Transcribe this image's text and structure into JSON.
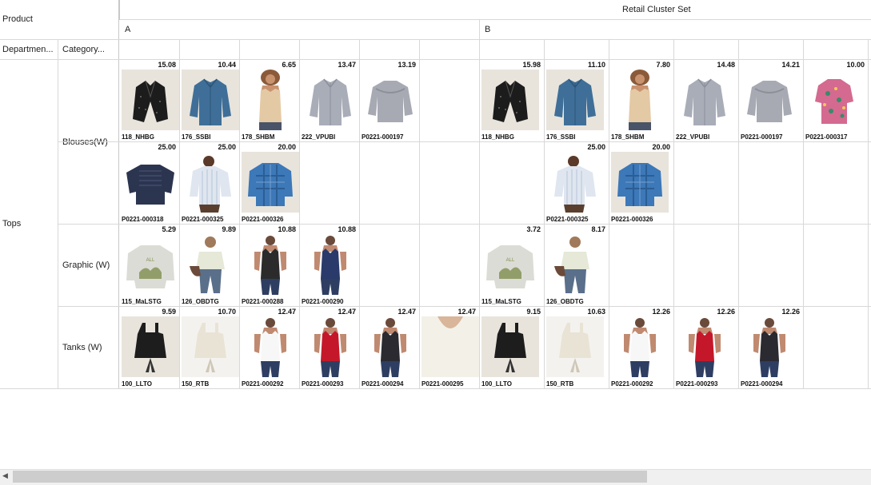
{
  "grid": {
    "row_dim_label": "Product",
    "col_dim_title": "Retail Cluster Set",
    "col_headers": [
      "Departmen...",
      "Category..."
    ],
    "clusters": [
      {
        "label": "A"
      },
      {
        "label": "B"
      }
    ],
    "department": "Tops",
    "categories": [
      {
        "label": "Blouses(W)"
      },
      {
        "label": "Graphic (W)"
      },
      {
        "label": "Tanks (W)"
      }
    ]
  },
  "rows": [
    {
      "A": [
        {
          "price": "15.08",
          "code": "118_NHBG",
          "kind": "blazer",
          "colors": [
            "#1c1c1c",
            "#bfbfbf"
          ],
          "bg": "#e8e4dc"
        },
        {
          "price": "10.44",
          "code": "176_SSBI",
          "kind": "shirt",
          "colors": [
            "#3f6f98",
            "#2c5578"
          ],
          "bg": "#e8e4dc"
        },
        {
          "price": "6.65",
          "code": "178_SHBM",
          "kind": "tank_model",
          "colors": [
            "#e4c9a5",
            "#8a5a3a"
          ],
          "bg": "#ffffff"
        },
        {
          "price": "13.47",
          "code": "222_VPUBI",
          "kind": "shirt",
          "colors": [
            "#a9adb8",
            "#8c909c"
          ],
          "bg": "#ffffff"
        },
        {
          "price": "13.19",
          "code": "P0221-000197",
          "kind": "ruffle",
          "colors": [
            "#a7aab3",
            "#8d9099"
          ],
          "bg": "#ffffff"
        },
        null
      ],
      "B": [
        {
          "price": "15.98",
          "code": "118_NHBG",
          "kind": "blazer",
          "colors": [
            "#1c1c1c",
            "#bfbfbf"
          ],
          "bg": "#e8e4dc"
        },
        {
          "price": "11.10",
          "code": "176_SSBI",
          "kind": "shirt",
          "colors": [
            "#3f6f98",
            "#2c5578"
          ],
          "bg": "#e8e4dc"
        },
        {
          "price": "7.80",
          "code": "178_SHBM",
          "kind": "tank_model",
          "colors": [
            "#e4c9a5",
            "#8a5a3a"
          ],
          "bg": "#ffffff"
        },
        {
          "price": "14.48",
          "code": "222_VPUBI",
          "kind": "shirt",
          "colors": [
            "#a9adb8",
            "#8c909c"
          ],
          "bg": "#ffffff"
        },
        {
          "price": "14.21",
          "code": "P0221-000197",
          "kind": "ruffle",
          "colors": [
            "#a7aab3",
            "#8d9099"
          ],
          "bg": "#ffffff"
        },
        {
          "price": "10.00",
          "code": "P0221-000317",
          "kind": "print",
          "colors": [
            "#d46a8f",
            "#3a8a6a"
          ],
          "bg": "#ffffff"
        }
      ]
    },
    {
      "A": [
        {
          "price": "25.00",
          "code": "P0221-000318",
          "kind": "smock",
          "colors": [
            "#2c3550",
            "#1f2740"
          ],
          "bg": "#ffffff"
        },
        {
          "price": "25.00",
          "code": "P0221-000325",
          "kind": "model_shirt",
          "colors": [
            "#dfe6ef",
            "#5b3a2a"
          ],
          "bg": "#ffffff"
        },
        {
          "price": "20.00",
          "code": "P0221-000326",
          "kind": "plaid",
          "colors": [
            "#3d78b8",
            "#27588c"
          ],
          "bg": "#e8e4dc"
        },
        null,
        null,
        null
      ],
      "B": [
        null,
        {
          "price": "25.00",
          "code": "P0221-000325",
          "kind": "model_shirt",
          "colors": [
            "#dfe6ef",
            "#5b3a2a"
          ],
          "bg": "#ffffff"
        },
        {
          "price": "20.00",
          "code": "P0221-000326",
          "kind": "plaid",
          "colors": [
            "#3d78b8",
            "#27588c"
          ],
          "bg": "#e8e4dc"
        },
        null,
        null,
        null
      ]
    },
    {
      "A": [
        {
          "price": "5.29",
          "code": "115_MaLSTG",
          "kind": "sweat",
          "colors": [
            "#dcdcd6",
            "#7f8f4f"
          ],
          "bg": "#ffffff"
        },
        {
          "price": "9.89",
          "code": "126_OBDTG",
          "kind": "model_sweat",
          "colors": [
            "#e6e8d8",
            "#5a6f8a"
          ],
          "bg": "#ffffff"
        },
        {
          "price": "10.88",
          "code": "P0221-000288",
          "kind": "model_tank",
          "colors": [
            "#2b2b2b",
            "#c08a70"
          ],
          "bg": "#ffffff"
        },
        {
          "price": "10.88",
          "code": "P0221-000290",
          "kind": "model_tank",
          "colors": [
            "#2a3a6a",
            "#c08a70"
          ],
          "bg": "#ffffff"
        },
        null,
        null
      ],
      "B": [
        {
          "price": "3.72",
          "code": "115_MaLSTG",
          "kind": "sweat",
          "colors": [
            "#dcdcd6",
            "#7f8f4f"
          ],
          "bg": "#ffffff"
        },
        {
          "price": "8.17",
          "code": "126_OBDTG",
          "kind": "model_sweat",
          "colors": [
            "#e6e8d8",
            "#5a6f8a"
          ],
          "bg": "#ffffff"
        },
        null,
        null,
        null,
        null
      ]
    },
    {
      "A": [
        {
          "price": "9.59",
          "code": "100_LLTO",
          "kind": "apron",
          "colors": [
            "#1d1d1d",
            "#333333"
          ],
          "bg": "#e8e4dc"
        },
        {
          "price": "10.70",
          "code": "150_RTB",
          "kind": "apron",
          "colors": [
            "#e9e3d6",
            "#cfc7b6"
          ],
          "bg": "#f4f2ee"
        },
        {
          "price": "12.47",
          "code": "P0221-000292",
          "kind": "model_tank",
          "colors": [
            "#f7f7f7",
            "#c08a70"
          ],
          "bg": "#ffffff"
        },
        {
          "price": "12.47",
          "code": "P0221-000293",
          "kind": "model_tank",
          "colors": [
            "#c4182a",
            "#c08a70"
          ],
          "bg": "#ffffff"
        },
        {
          "price": "12.47",
          "code": "P0221-000294",
          "kind": "model_tank",
          "colors": [
            "#2a2a30",
            "#c08a70"
          ],
          "bg": "#ffffff"
        },
        {
          "price": "12.47",
          "code": "P0221-000295",
          "kind": "closeup",
          "colors": [
            "#f3f0e8",
            "#d9b59a"
          ],
          "bg": "#ffffff"
        }
      ],
      "B": [
        {
          "price": "9.15",
          "code": "100_LLTO",
          "kind": "apron",
          "colors": [
            "#1d1d1d",
            "#333333"
          ],
          "bg": "#e8e4dc"
        },
        {
          "price": "10.63",
          "code": "150_RTB",
          "kind": "apron",
          "colors": [
            "#e9e3d6",
            "#cfc7b6"
          ],
          "bg": "#f4f2ee"
        },
        {
          "price": "12.26",
          "code": "P0221-000292",
          "kind": "model_tank",
          "colors": [
            "#f7f7f7",
            "#c08a70"
          ],
          "bg": "#ffffff"
        },
        {
          "price": "12.26",
          "code": "P0221-000293",
          "kind": "model_tank",
          "colors": [
            "#c4182a",
            "#c08a70"
          ],
          "bg": "#ffffff"
        },
        {
          "price": "12.26",
          "code": "P0221-000294",
          "kind": "model_tank",
          "colors": [
            "#2a2a30",
            "#c08a70"
          ],
          "bg": "#ffffff"
        },
        null
      ]
    }
  ],
  "scrollbar": {
    "arrow_icon": "scroll-left-arrow-icon",
    "arrow_glyph": "◀"
  }
}
